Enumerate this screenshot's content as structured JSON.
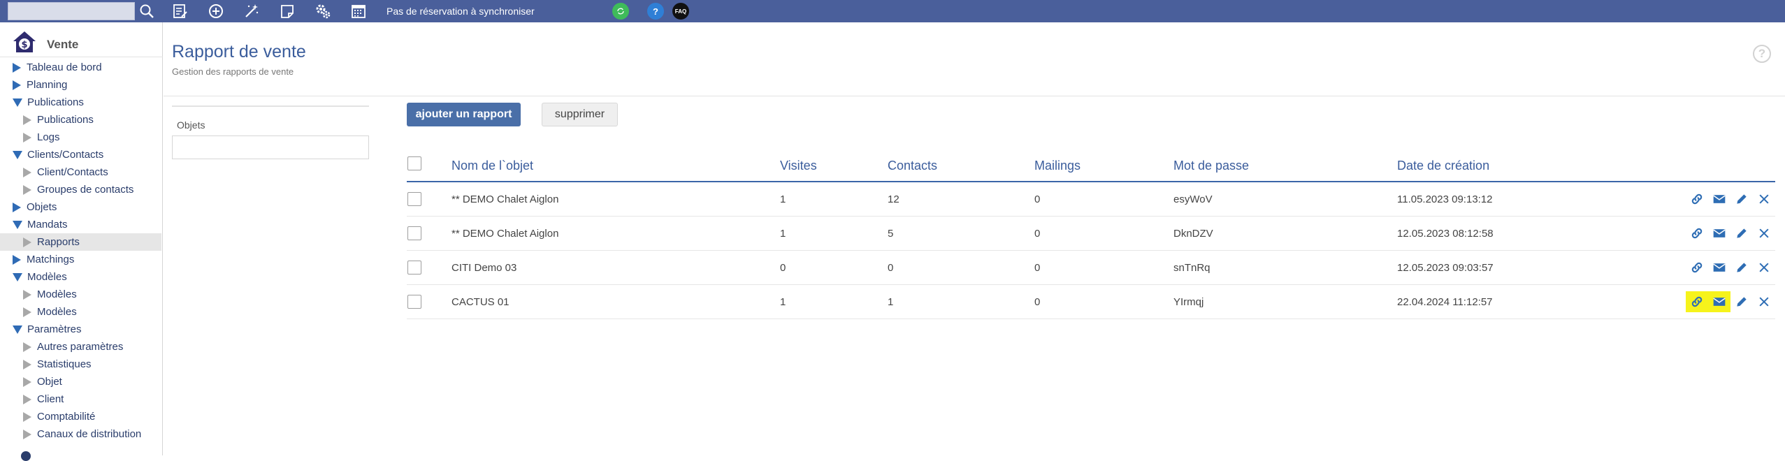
{
  "topbar": {
    "search_placeholder": "",
    "sync_status": "Pas de réservation à synchroniser",
    "help_label": "?",
    "faq_label": "FAQ",
    "icons": [
      "search-icon",
      "document-edit-icon",
      "add-circle-icon",
      "magic-wand-icon",
      "notepad-icon",
      "gears-icon",
      "calendar-icon",
      "green-sync-icon",
      "help-icon",
      "faq-icon"
    ],
    "colors": {
      "bar": "#4a5f9b",
      "green": "#3fbb5a",
      "blue": "#2f7fd6"
    }
  },
  "sidebar": {
    "module_title": "Vente",
    "items": [
      {
        "label": "Tableau de bord",
        "level": 1,
        "arrow": "right"
      },
      {
        "label": "Planning",
        "level": 1,
        "arrow": "right"
      },
      {
        "label": "Publications",
        "level": 1,
        "arrow": "down"
      },
      {
        "label": "Publications",
        "level": 2,
        "arrow": "grey"
      },
      {
        "label": "Logs",
        "level": 2,
        "arrow": "grey"
      },
      {
        "label": "Clients/Contacts",
        "level": 1,
        "arrow": "down"
      },
      {
        "label": "Client/Contacts",
        "level": 2,
        "arrow": "grey"
      },
      {
        "label": "Groupes de contacts",
        "level": 2,
        "arrow": "grey"
      },
      {
        "label": "Objets",
        "level": 1,
        "arrow": "right"
      },
      {
        "label": "Mandats",
        "level": 1,
        "arrow": "down"
      },
      {
        "label": "Rapports",
        "level": 2,
        "arrow": "grey",
        "active": true
      },
      {
        "label": "Matchings",
        "level": 1,
        "arrow": "right"
      },
      {
        "label": "Modèles",
        "level": 1,
        "arrow": "down"
      },
      {
        "label": "Modèles",
        "level": 2,
        "arrow": "grey"
      },
      {
        "label": "Modèles",
        "level": 2,
        "arrow": "grey"
      },
      {
        "label": "Paramètres",
        "level": 1,
        "arrow": "down"
      },
      {
        "label": "Autres paramètres",
        "level": 2,
        "arrow": "grey"
      },
      {
        "label": "Statistiques",
        "level": 2,
        "arrow": "grey"
      },
      {
        "label": "Objet",
        "level": 2,
        "arrow": "grey"
      },
      {
        "label": "Client",
        "level": 2,
        "arrow": "grey"
      },
      {
        "label": "Comptabilité",
        "level": 2,
        "arrow": "grey"
      },
      {
        "label": "Canaux de distribution",
        "level": 2,
        "arrow": "grey"
      }
    ]
  },
  "header": {
    "title": "Rapport de vente",
    "subtitle": "Gestion des rapports de vente",
    "help_label": "?"
  },
  "filter": {
    "label": "Objets",
    "value": ""
  },
  "toolbar": {
    "add_label": "ajouter un rapport",
    "delete_label": "supprimer"
  },
  "table": {
    "columns": [
      "Nom de l`objet",
      "Visites",
      "Contacts",
      "Mailings",
      "Mot de passe",
      "Date de création"
    ],
    "rows": [
      {
        "name": "** DEMO Chalet Aiglon",
        "visits": "1",
        "contacts": "12",
        "mailings": "0",
        "password": "esyWoV",
        "created": "11.05.2023 09:13:12",
        "highlight": false
      },
      {
        "name": "** DEMO Chalet Aiglon",
        "visits": "1",
        "contacts": "5",
        "mailings": "0",
        "password": "DknDZV",
        "created": "12.05.2023 08:12:58",
        "highlight": false
      },
      {
        "name": "CITI Demo 03",
        "visits": "0",
        "contacts": "0",
        "mailings": "0",
        "password": "snTnRq",
        "created": "12.05.2023 09:03:57",
        "highlight": false
      },
      {
        "name": "CACTUS 01",
        "visits": "1",
        "contacts": "1",
        "mailings": "0",
        "password": "YIrmqj",
        "created": "22.04.2024 11:12:57",
        "highlight": true
      }
    ],
    "row_actions": [
      "link-icon",
      "envelope-icon",
      "pencil-icon",
      "close-icon"
    ],
    "colors": {
      "accent": "#3b66a8",
      "action": "#2e6db4",
      "highlight": "#f6f31b"
    }
  }
}
